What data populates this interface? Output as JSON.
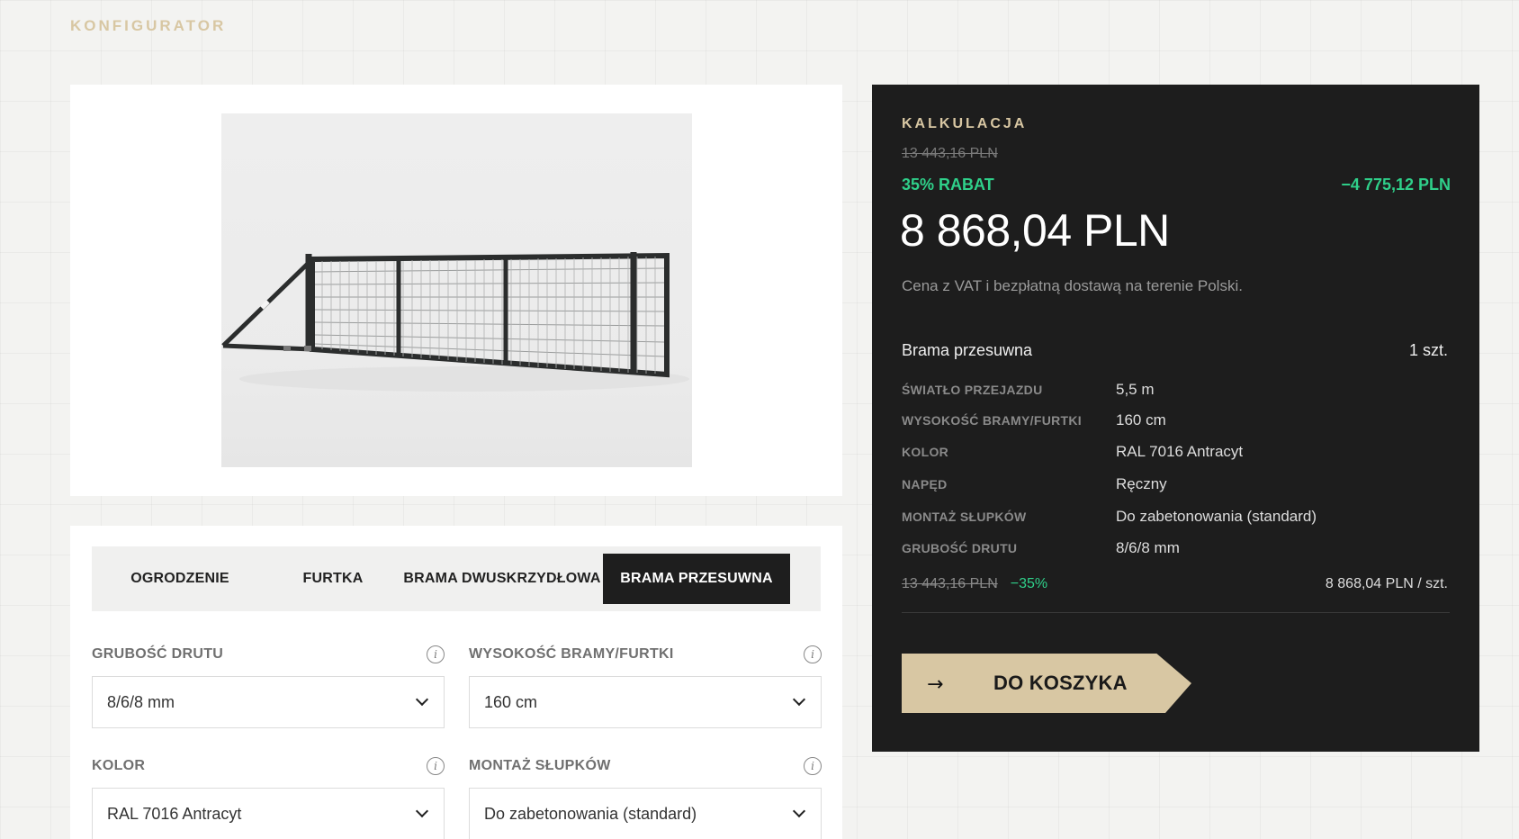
{
  "header": {
    "brand": "KONFIGURATOR"
  },
  "tabs": [
    {
      "label": "OGRODZENIE",
      "active": false
    },
    {
      "label": "FURTKA",
      "active": false
    },
    {
      "label": "BRAMA DWUSKRZYDŁOWA",
      "active": false
    },
    {
      "label": "BRAMA PRZESUWNA",
      "active": true
    }
  ],
  "fields": {
    "wire": {
      "label": "GRUBOŚĆ DRUTU",
      "value": "8/6/8 mm",
      "info": "i"
    },
    "height": {
      "label": "WYSOKOŚĆ BRAMY/FURTKI",
      "value": "160 cm",
      "info": "i"
    },
    "color": {
      "label": "KOLOR",
      "value": "RAL 7016 Antracyt",
      "info": "i"
    },
    "mount": {
      "label": "MONTAŻ SŁUPKÓW",
      "value": "Do zabetonowania (standard)",
      "info": "i"
    }
  },
  "calc": {
    "title": "KALKULACJA",
    "old_price": "13 443,16 PLN",
    "discount_label": "35% RABAT",
    "discount_amount": "−4 775,12 PLN",
    "total": "8 868,04 PLN",
    "note": "Cena z VAT i bezpłatną dostawą na terenie Polski.",
    "product": {
      "name": "Brama przesuwna",
      "qty": "1 szt."
    },
    "specs": [
      {
        "key": "ŚWIATŁO PRZEJAZDU",
        "value": "5,5 m"
      },
      {
        "key": "WYSOKOŚĆ BRAMY/FURTKI",
        "value": "160 cm"
      },
      {
        "key": "KOLOR",
        "value": "RAL 7016 Antracyt"
      },
      {
        "key": "NAPĘD",
        "value": "Ręczny"
      },
      {
        "key": "MONTAŻ SŁUPKÓW",
        "value": "Do zabetonowania (standard)"
      },
      {
        "key": "GRUBOŚĆ DRUTU",
        "value": "8/6/8 mm"
      }
    ],
    "line": {
      "old": "13 443,16 PLN",
      "pct": "−35%",
      "unit_price": "8 868,04 PLN / szt."
    },
    "cart_button": {
      "label": "DO KOSZYKA",
      "icon": "arrow-right-icon"
    }
  },
  "colors": {
    "accent": "#d8c7a3",
    "discount": "#2fd08a",
    "panel": "#1d1d1d"
  }
}
